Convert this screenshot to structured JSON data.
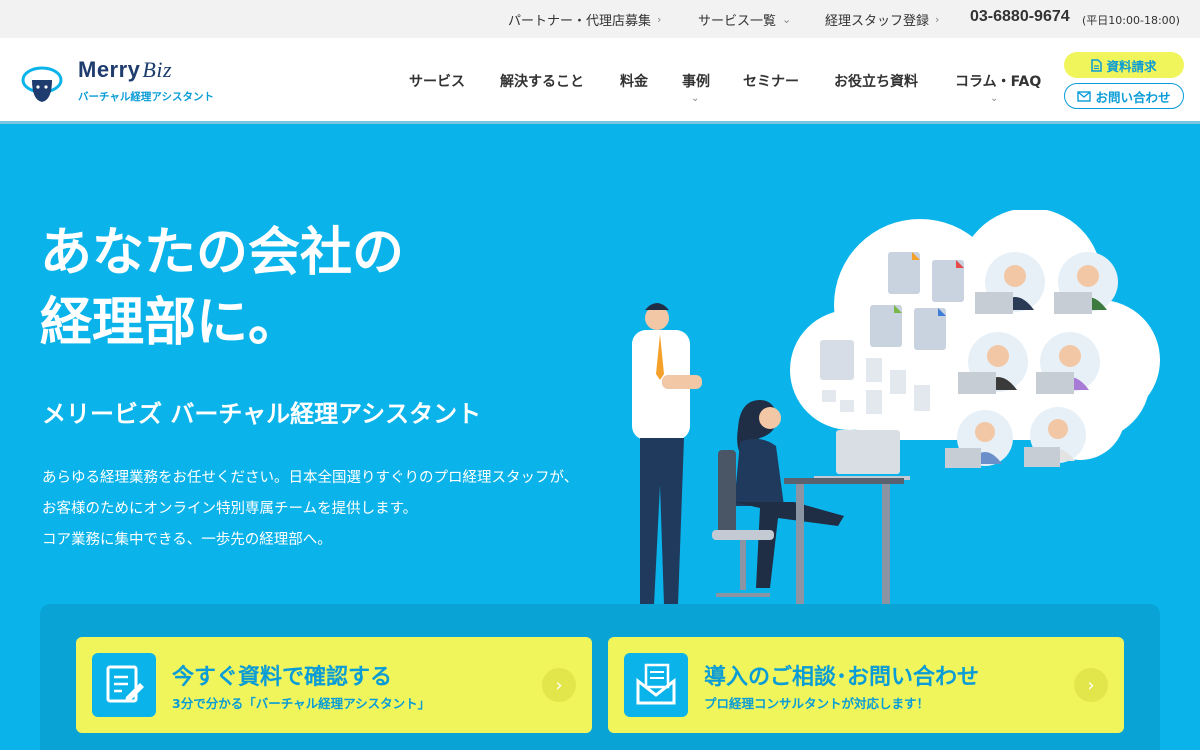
{
  "topbar": {
    "partner": "パートナー・代理店募集",
    "services": "サービス一覧",
    "staff": "経理スタッフ登録",
    "phone": "03-6880-9674",
    "hours": "(平日10:00-18:00)"
  },
  "logo": {
    "word_main": "Merry",
    "word_biz": "Biz",
    "tagline": "バーチャル経理アシスタント"
  },
  "nav": {
    "items": [
      {
        "label": "サービス"
      },
      {
        "label": "解決すること"
      },
      {
        "label": "料金"
      },
      {
        "label": "事例"
      },
      {
        "label": "セミナー"
      },
      {
        "label": "お役立ち資料"
      },
      {
        "label": "コラム・FAQ"
      }
    ]
  },
  "header_buttons": {
    "doc_request": "資料請求",
    "contact": "お問い合わせ"
  },
  "hero": {
    "title_line1": "あなたの会社の",
    "title_line2": "経理部に。",
    "subtitle": "メリービズ バーチャル経理アシスタント",
    "desc_line1": "あらゆる経理業務をお任せください。日本全国選りすぐりのプロ経理スタッフが、",
    "desc_line2": "お客様のためにオンライン特別専属チームを提供します。",
    "desc_line3": "コア業務に集中できる、一歩先の経理部へ。"
  },
  "cta": [
    {
      "title": "今すぐ資料で確認する",
      "note": "3分で分かる「バーチャル経理アシスタント」"
    },
    {
      "title": "導入のご相談･お問い合わせ",
      "note": "プロ経理コンサルタントが対応します！"
    }
  ],
  "colors": {
    "brand_blue": "#0ab4ea",
    "accent_yellow": "#f0f55c",
    "navy": "#1f3c6e"
  }
}
